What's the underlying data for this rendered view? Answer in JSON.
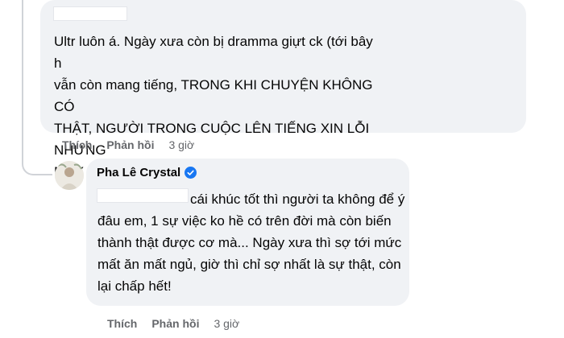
{
  "comment_1": {
    "text": "Ultr luôn á. Ngày xưa còn bị dramma giựt ck (tới bây h\nvẫn còn mang tiếng, TRONG KHI CHUYỆN KHÔNG CÓ\nTHẬT, NGƯỜI TRONG CUỘC LÊN TIẾNG XIN LỖI NHƯNG\nMẤY AI ĐỌC) chị tui số thị phi.",
    "actions": {
      "like": "Thích",
      "reply": "Phản hồi",
      "time": "3 giờ"
    }
  },
  "comment_2": {
    "author": "Pha Lê Crystal",
    "verified": true,
    "text": "cái khúc tốt thì người ta không để ý đâu em, 1 sự việc ko hề có trên đời mà còn biến thành thật được cơ mà... Ngày xưa thì sợ tới mức mất ăn mất ngủ, giờ thì chỉ sợ nhất là sự thật, còn lại chấp hết!",
    "actions": {
      "like": "Thích",
      "reply": "Phản hồi",
      "time": "3 giờ"
    }
  },
  "colors": {
    "bubble": "#f0f2f5",
    "meta_text": "#65676b",
    "verified": "#1877f2"
  }
}
